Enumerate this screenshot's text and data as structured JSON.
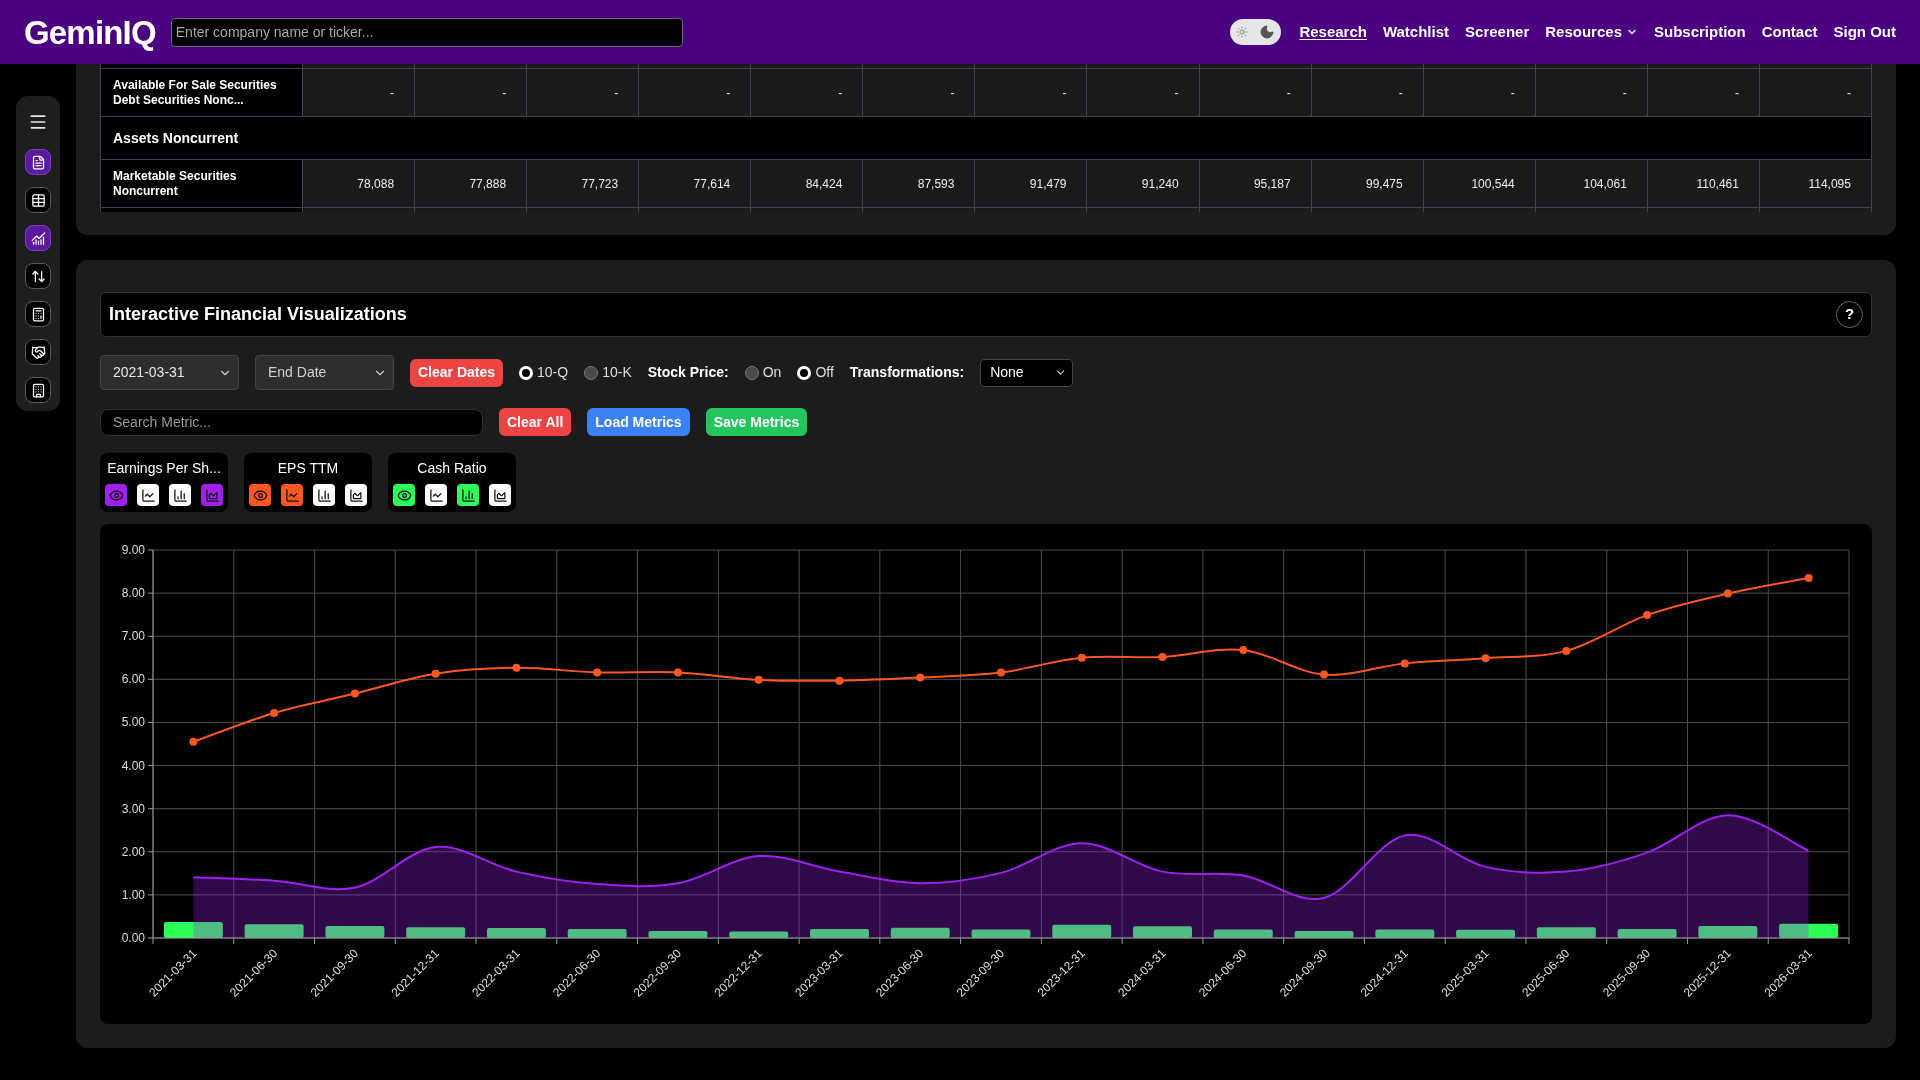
{
  "nav": {
    "logo": "GeminIQ",
    "search": {
      "placeholder": "Enter company name or ticker..."
    },
    "theme_toggle": {
      "dark_mode": true
    },
    "links": [
      {
        "label": "Research",
        "selected": true,
        "dropdown": false
      },
      {
        "label": "Watchlist",
        "selected": false,
        "dropdown": false
      },
      {
        "label": "Screener",
        "selected": false,
        "dropdown": false
      },
      {
        "label": "Resources",
        "selected": false,
        "dropdown": true
      },
      {
        "label": "Subscription",
        "selected": false,
        "dropdown": false
      },
      {
        "label": "Contact",
        "selected": false,
        "dropdown": false
      },
      {
        "label": "Sign Out",
        "selected": false,
        "dropdown": false
      }
    ]
  },
  "sidebar": {
    "items": [
      {
        "kind": "document",
        "selected": true
      },
      {
        "kind": "table",
        "selected": false
      },
      {
        "kind": "chart",
        "selected": true
      },
      {
        "kind": "transfer",
        "selected": false
      },
      {
        "kind": "calculator",
        "selected": false
      },
      {
        "kind": "handshake",
        "selected": false
      },
      {
        "kind": "ledger",
        "selected": false
      }
    ]
  },
  "table": {
    "rows": [
      {
        "kind": "data",
        "label": "Available For Sale Securities Debt Securities Nonc...",
        "cells": [
          "-",
          "-",
          "-",
          "-",
          "-",
          "-",
          "-",
          "-",
          "-",
          "-",
          "-",
          "-",
          "-",
          "-"
        ]
      },
      {
        "kind": "section",
        "label": "Assets Noncurrent"
      },
      {
        "kind": "data",
        "label": "Marketable Securities Noncurrent",
        "cells": [
          "78,088",
          "77,888",
          "77,723",
          "77,614",
          "84,424",
          "87,593",
          "91,479",
          "91,240",
          "95,187",
          "99,475",
          "100,544",
          "104,061",
          "110,461",
          "114,095"
        ]
      }
    ]
  },
  "visualization": {
    "title": "Interactive Financial Visualizations",
    "help": "?",
    "start_date": {
      "value": "2021-03-31"
    },
    "end_date": {
      "placeholder": "End Date"
    },
    "clear_dates": "Clear Dates",
    "filing_types": [
      {
        "label": "10-Q",
        "selected": true
      },
      {
        "label": "10-K",
        "selected": false
      }
    ],
    "stock_price": {
      "label": "Stock Price:",
      "options": [
        {
          "label": "On",
          "selected": false
        },
        {
          "label": "Off",
          "selected": true
        }
      ]
    },
    "transformations": {
      "label": "Transformations:",
      "value": "None"
    },
    "metric_search": {
      "placeholder": "Search Metric..."
    },
    "buttons": [
      {
        "label": "Clear All",
        "kind": "danger"
      },
      {
        "label": "Load Metrics",
        "kind": "primary"
      },
      {
        "label": "Save Metrics",
        "kind": "success"
      }
    ],
    "metrics": [
      {
        "label": "Earnings Per Sh...",
        "color": "#a020f0",
        "visible": true,
        "chart_types": [
          {
            "kind": "line",
            "selected": false
          },
          {
            "kind": "bar",
            "selected": false
          },
          {
            "kind": "area",
            "selected": true
          }
        ]
      },
      {
        "label": "EPS TTM",
        "color": "#ff5722",
        "visible": true,
        "chart_types": [
          {
            "kind": "line",
            "selected": true
          },
          {
            "kind": "bar",
            "selected": false
          },
          {
            "kind": "area",
            "selected": false
          }
        ]
      },
      {
        "label": "Cash Ratio",
        "color": "#2dff57",
        "visible": true,
        "chart_types": [
          {
            "kind": "line",
            "selected": false
          },
          {
            "kind": "bar",
            "selected": true
          },
          {
            "kind": "area",
            "selected": false
          }
        ]
      }
    ],
    "chart_data": {
      "type": "line",
      "grid": true,
      "categories": [
        "2021-03-31",
        "2021-06-30",
        "2021-09-30",
        "2021-12-31",
        "2022-03-31",
        "2022-06-30",
        "2022-09-30",
        "2022-12-31",
        "2023-03-31",
        "2023-06-30",
        "2023-09-30",
        "2023-12-31",
        "2024-03-31",
        "2024-06-30",
        "2024-09-30",
        "2024-12-31",
        "2025-03-31",
        "2025-06-30",
        "2025-09-30",
        "2025-12-31",
        "2026-03-31"
      ],
      "series": [
        {
          "type": "bar",
          "color": "#2dff57",
          "values": [
            0.37,
            0.32,
            0.28,
            0.25,
            0.23,
            0.21,
            0.16,
            0.15,
            0.21,
            0.24,
            0.2,
            0.31,
            0.27,
            0.2,
            0.16,
            0.2,
            0.19,
            0.25,
            0.21,
            0.28,
            0.33
          ]
        },
        {
          "type": "area",
          "color": "#a020f0",
          "values": [
            1.41,
            1.33,
            1.17,
            2.11,
            1.54,
            1.25,
            1.27,
            1.9,
            1.54,
            1.27,
            1.51,
            2.2,
            1.54,
            1.45,
            0.93,
            2.38,
            1.65,
            1.54,
            1.98,
            2.85,
            2.02
          ]
        },
        {
          "color": "#ff5722",
          "marker": "circle",
          "values": [
            4.55,
            5.22,
            5.67,
            6.13,
            6.27,
            6.16,
            6.16,
            5.99,
            5.97,
            6.04,
            6.16,
            6.5,
            6.52,
            6.68,
            6.11,
            6.37,
            6.49,
            6.66,
            7.49,
            7.99,
            8.35
          ]
        }
      ],
      "ylim": [
        0,
        9
      ],
      "yticks": [
        {
          "value": 0,
          "label": "0.00"
        },
        {
          "value": 1,
          "label": "1.00"
        },
        {
          "value": 2,
          "label": "2.00"
        },
        {
          "value": 3,
          "label": "3.00"
        },
        {
          "value": 4,
          "label": "4.00"
        },
        {
          "value": 5,
          "label": "5.00"
        },
        {
          "value": 6,
          "label": "6.00"
        },
        {
          "value": 7,
          "label": "7.00"
        },
        {
          "value": 8,
          "label": "8.00"
        },
        {
          "value": 9,
          "label": "9.00"
        }
      ]
    }
  }
}
